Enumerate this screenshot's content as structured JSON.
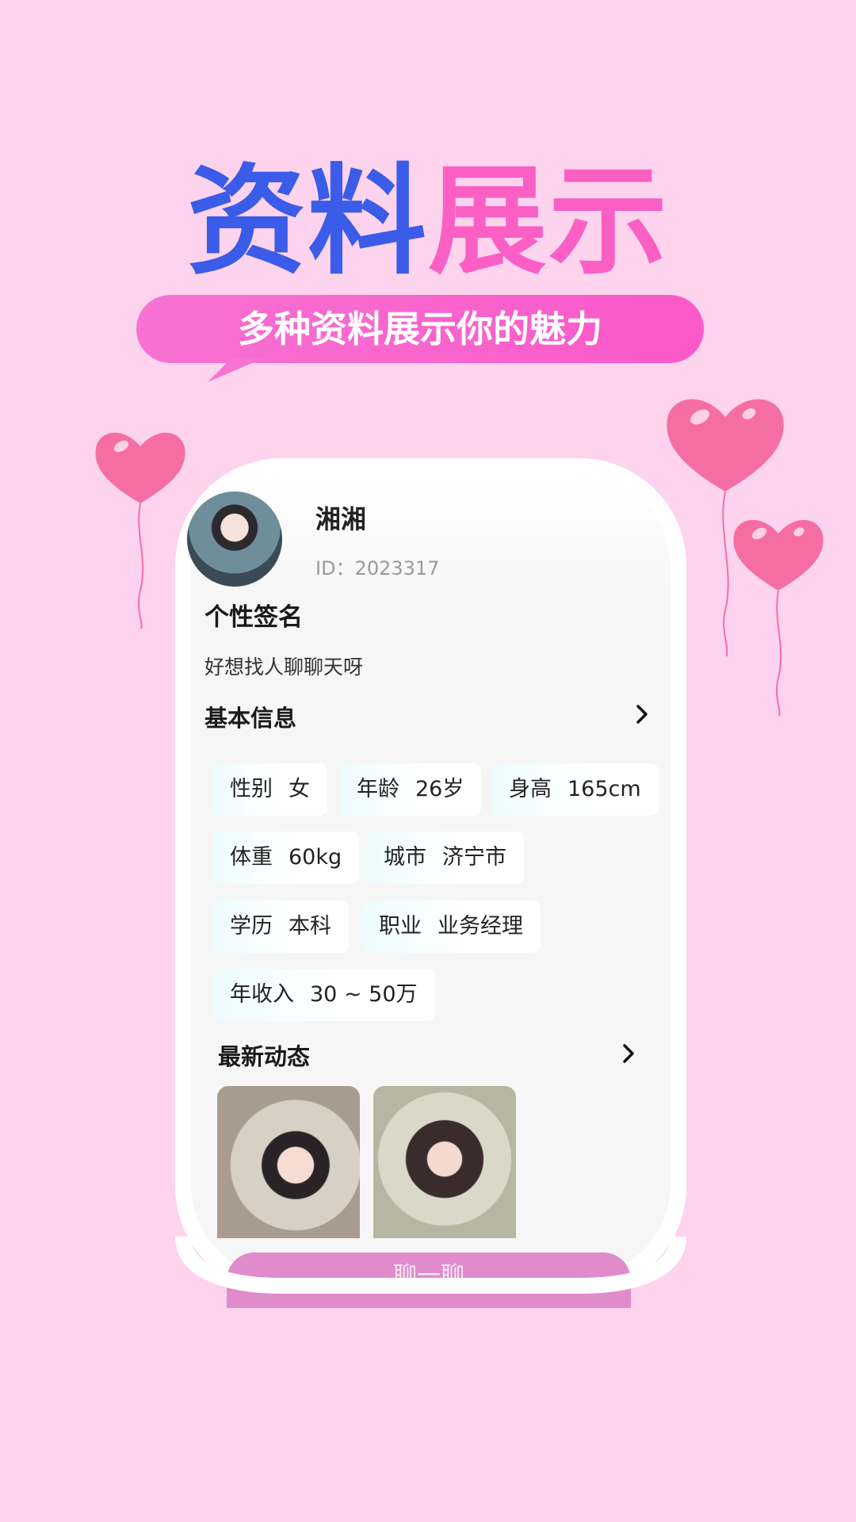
{
  "promo": {
    "title_part1": "资料",
    "title_part2": "展示",
    "subtitle": "多种资料展示你的魅力"
  },
  "profile": {
    "nickname": "湘湘",
    "id_text": "ID：2023317"
  },
  "signature": {
    "title": "个性签名",
    "text": "好想找人聊聊天呀"
  },
  "basic_info": {
    "title": "基本信息",
    "tags": [
      {
        "key": "性别",
        "value": "女"
      },
      {
        "key": "年龄",
        "value": "26岁"
      },
      {
        "key": "身高",
        "value": "165cm"
      },
      {
        "key": "体重",
        "value": "60kg"
      },
      {
        "key": "城市",
        "value": "济宁市"
      },
      {
        "key": "学历",
        "value": "本科"
      },
      {
        "key": "职业",
        "value": "业务经理"
      },
      {
        "key": "年收入",
        "value": "30 ~ 50万"
      }
    ]
  },
  "moments": {
    "title": "最新动态"
  },
  "bottom_button": {
    "label": "聊一聊"
  },
  "colors": {
    "background": "#fed3ee",
    "title_blue": "#3b5ce8",
    "title_pink": "#fb5fc4",
    "heart": "#f56ea3"
  }
}
